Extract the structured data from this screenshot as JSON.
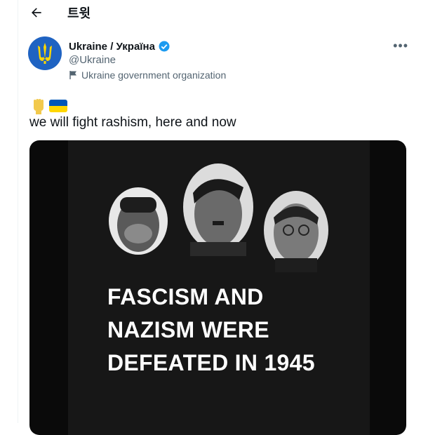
{
  "header": {
    "back_label": "←",
    "title": "트윗"
  },
  "tweet": {
    "display_name": "Ukraine / Україна",
    "handle": "@Ukraine",
    "label": "Ukraine government organization",
    "text": "we will fight rashism, here and now",
    "emojis": [
      "fist-icon",
      "ukraine-flag-icon"
    ],
    "more_label": "•••",
    "media": {
      "headline_lines": [
        "FASCISM AND",
        "NAZISM WERE",
        "DEFEATED IN 1945"
      ]
    }
  },
  "colors": {
    "verified": "#1d9bf0",
    "avatar_bg": "#1f63c2",
    "flag_blue": "#0057b8",
    "flag_yellow": "#ffd700"
  }
}
